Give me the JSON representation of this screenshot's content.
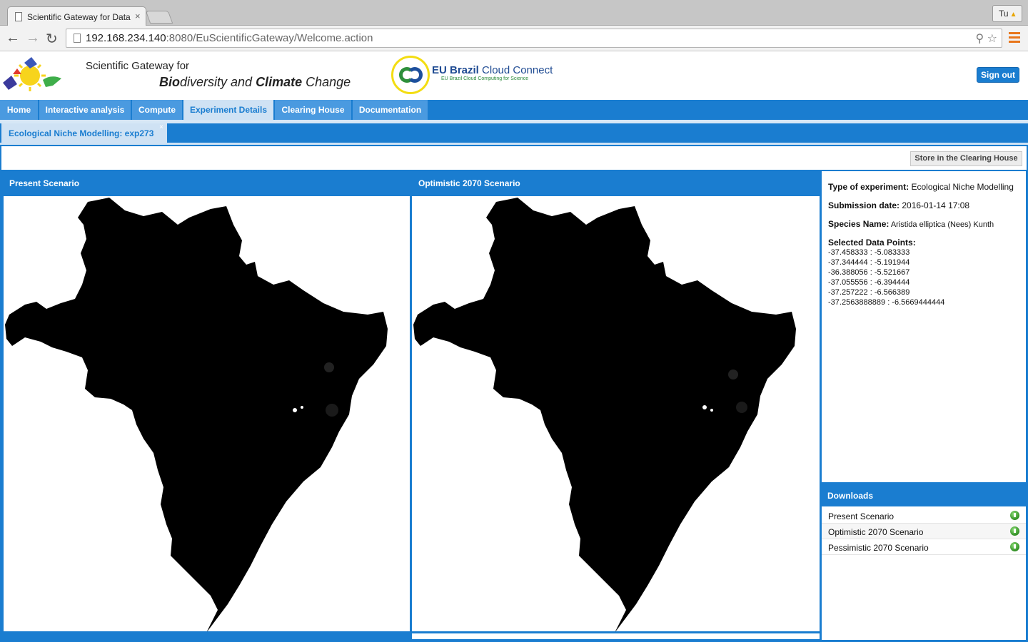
{
  "browser": {
    "tab_title": "Scientific Gateway for Data",
    "tab_close": "×",
    "user_badge": "Tu",
    "url_host": "192.168.234.140",
    "url_rest": ":8080/EuScientificGateway/Welcome.action",
    "icons": [
      "back-icon",
      "forward-icon",
      "reload-icon",
      "search-icon",
      "star-icon",
      "menu-icon"
    ]
  },
  "header": {
    "gateway_line1": "Scientific Gateway for",
    "gateway_bio": "Bio",
    "gateway_diversity": "diversity and ",
    "gateway_climate": "Climate",
    "gateway_change": " Change",
    "eu_name_bold": "EU Brazil",
    "eu_name_rest": " Cloud Connect",
    "eu_sub": "EU Brazil Cloud Computing for Science",
    "signout": "Sign out"
  },
  "nav": {
    "items": [
      "Home",
      "Interactive analysis",
      "Compute",
      "Experiment Details",
      "Clearing House",
      "Documentation"
    ],
    "active": "Experiment Details"
  },
  "subtab": {
    "label": "Ecological Niche Modelling: exp273",
    "close": "×"
  },
  "actions": {
    "store": "Store in the Clearing House"
  },
  "panels": {
    "present": "Present Scenario",
    "optimistic": "Optimistic 2070 Scenario"
  },
  "info": {
    "type_label": "Type of experiment:",
    "type_value": " Ecological Niche Modelling",
    "date_label": "Submission date:",
    "date_value": " 2016-01-14 17:08",
    "species_label": "Species Name:",
    "species_value": " Aristida elliptica (Nees) Kunth",
    "points_label": "Selected Data Points:",
    "points": [
      "-37.458333 : -5.083333",
      "-37.344444 : -5.191944",
      "-36.388056 : -5.521667",
      "-37.055556 : -6.394444",
      "-37.257222 : -6.566389",
      "-37.2563888889 : -6.5669444444"
    ]
  },
  "downloads": {
    "title": "Downloads",
    "items": [
      "Present Scenario",
      "Optimistic 2070 Scenario",
      "Pessimistic 2070 Scenario"
    ]
  },
  "colors": {
    "brand_blue": "#1a7dd0",
    "active_tab": "#cfe2f4",
    "download_green": "#2f8d22"
  }
}
